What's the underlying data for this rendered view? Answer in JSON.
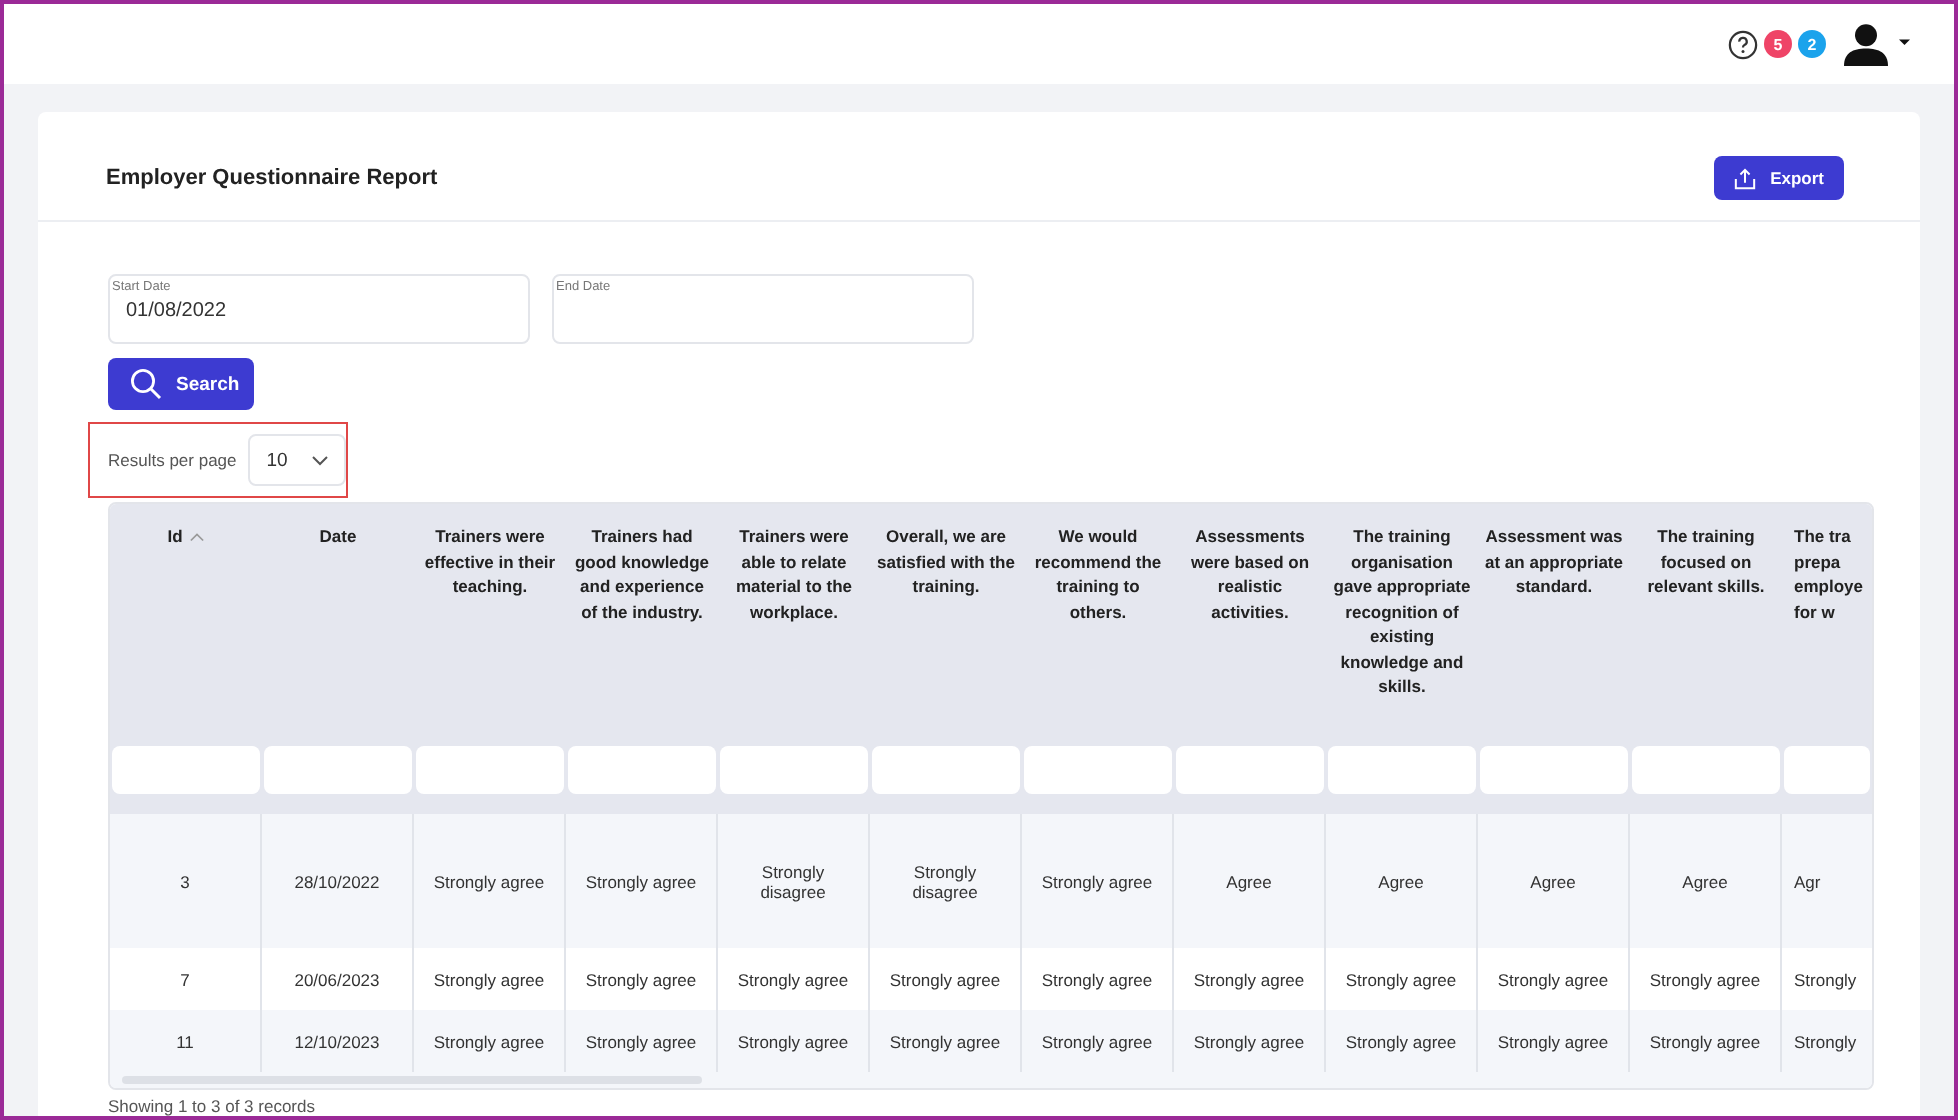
{
  "header": {
    "badges": [
      {
        "count": "5",
        "color": "#ef4467"
      },
      {
        "count": "2",
        "color": "#1ba3ec"
      }
    ]
  },
  "report": {
    "title": "Employer Questionnaire Report",
    "export_button": "Export",
    "filters": [
      {
        "label": "Start Date",
        "value": "01/08/2022"
      },
      {
        "label": "End Date"
      }
    ],
    "search_button": "Search",
    "results_per_page": {
      "label": "Results per page",
      "value": "10",
      "highlighted": true
    }
  },
  "table": {
    "columns": [
      {
        "label": "Id",
        "sorted": true
      },
      {
        "label": "Date",
        "sorted": false
      },
      {
        "label": "Trainers were effective in their teaching.",
        "sorted": false
      },
      {
        "label": "Trainers had good knowledge and experience of the industry.",
        "sorted": false
      },
      {
        "label": "Trainers were able to relate material to the workplace.",
        "sorted": false
      },
      {
        "label": "Overall, we are satisfied with the training.",
        "sorted": false
      },
      {
        "label": "We would recommend the training to others.",
        "sorted": false
      },
      {
        "label": "Assessments were based on realistic activities.",
        "sorted": false
      },
      {
        "label": "The training organisation gave appropriate recognition of existing knowledge and skills.",
        "sorted": false
      },
      {
        "label": "Assessment was at an appropriate standard.",
        "sorted": false
      },
      {
        "label": "The training focused on relevant skills.",
        "sorted": false
      },
      {
        "label": "The tra prepa employe for w",
        "sorted": false
      }
    ],
    "rows": [
      [
        "3",
        "28/10/2022",
        "Strongly agree",
        "Strongly agree",
        "Strongly disagree",
        "Strongly disagree",
        "Strongly agree",
        "Agree",
        "Agree",
        "Agree",
        "Agree",
        "Agr"
      ],
      [
        "7",
        "20/06/2023",
        "Strongly agree",
        "Strongly agree",
        "Strongly agree",
        "Strongly agree",
        "Strongly agree",
        "Strongly agree",
        "Strongly agree",
        "Strongly agree",
        "Strongly agree",
        "Strongly"
      ],
      [
        "11",
        "12/10/2023",
        "Strongly agree",
        "Strongly agree",
        "Strongly agree",
        "Strongly agree",
        "Strongly agree",
        "Strongly agree",
        "Strongly agree",
        "Strongly agree",
        "Strongly agree",
        "Strongly"
      ]
    ]
  },
  "footer": "Showing 1 to 3 of 3 records"
}
